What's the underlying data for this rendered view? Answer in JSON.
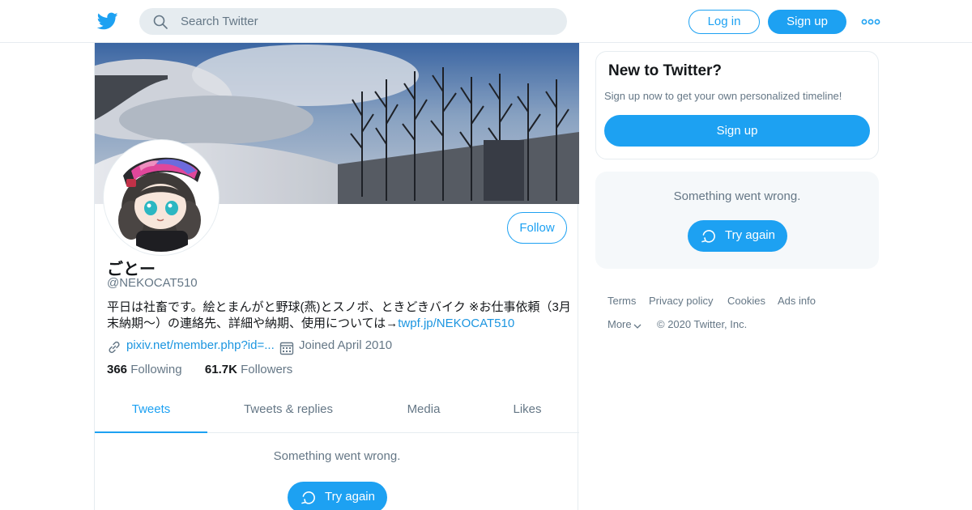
{
  "header": {
    "search_placeholder": "Search Twitter",
    "login_label": "Log in",
    "signup_label": "Sign up"
  },
  "profile": {
    "name": "ごとー",
    "handle": "@NEKOCAT510",
    "bio_text": "平日は社畜です。絵とまんがと野球(燕)とスノボ、ときどきバイク ※お仕事依頼（3月末納期〜）の連絡先、詳細や納期、使用については→",
    "bio_link": "twpf.jp/NEKOCAT510",
    "website": "pixiv.net/member.php?id=...",
    "joined": "Joined April 2010",
    "following_count": "366",
    "following_label": "Following",
    "followers_count": "61.7K",
    "followers_label": "Followers",
    "follow_label": "Follow"
  },
  "tabs": [
    {
      "label": "Tweets",
      "active": true
    },
    {
      "label": "Tweets & replies",
      "active": false
    },
    {
      "label": "Media",
      "active": false
    },
    {
      "label": "Likes",
      "active": false
    }
  ],
  "timeline": {
    "error_text": "Something went wrong.",
    "retry_label": "Try again"
  },
  "sidebar": {
    "new_title": "New to Twitter?",
    "new_subtitle": "Sign up now to get your own personalized timeline!",
    "new_signup_label": "Sign up",
    "error_text": "Something went wrong.",
    "retry_label": "Try again"
  },
  "footer": {
    "terms": "Terms",
    "privacy": "Privacy policy",
    "cookies": "Cookies",
    "ads": "Ads info",
    "more": "More",
    "copyright": "© 2020 Twitter, Inc."
  },
  "colors": {
    "accent": "#1da1f2",
    "link": "#1b95e0",
    "secondary_text": "#657786",
    "border": "#e6ecf0",
    "card_bg": "#f5f8fa"
  },
  "icons": [
    "twitter-bird-icon",
    "search-icon",
    "more-dots-icon",
    "link-icon",
    "calendar-icon",
    "refresh-icon",
    "chevron-down-icon"
  ]
}
